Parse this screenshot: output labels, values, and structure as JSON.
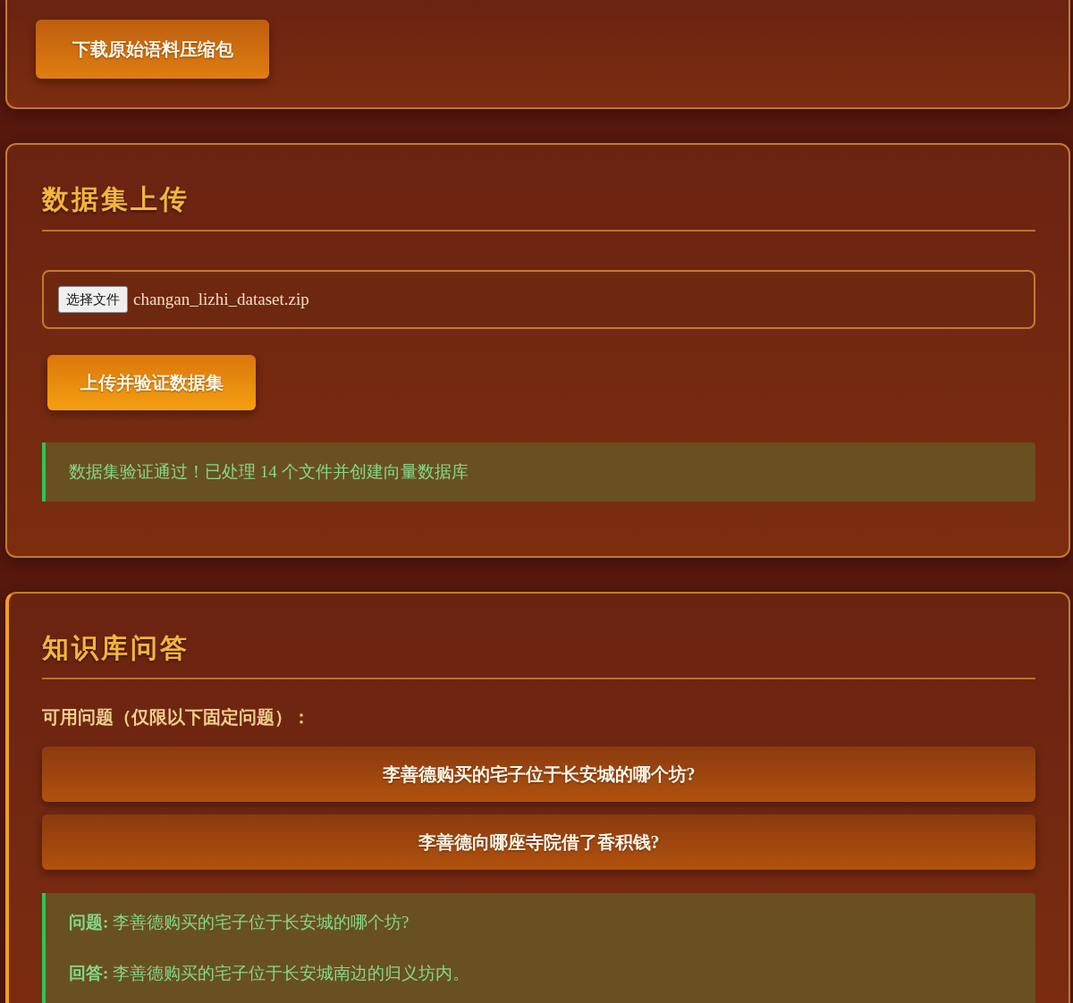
{
  "download_section": {
    "button": "下载原始语料压缩包"
  },
  "upload_section": {
    "title": "数据集上传",
    "file_input": {
      "button": "选择文件",
      "value": "changan_lizhi_dataset.zip"
    },
    "upload_button": "上传并验证数据集",
    "alert": {
      "kind": "success",
      "text": "数据集验证通过！已处理 14 个文件并创建向量数据库"
    }
  },
  "qa_section": {
    "title": "知识库问答",
    "questions_label": "可用问题（仅限以下固定问题）：",
    "questions": [
      "李善德购买的宅子位于长安城的哪个坊?",
      "李善德向哪座寺院借了香积钱?"
    ],
    "result": {
      "kind": "success",
      "lines": [
        "**问题:** 李善德购买的宅子位于长安城的哪个坊?",
        "**回答:** 李善德购买的宅子位于长安城南边的归义坊内。"
      ]
    }
  }
}
